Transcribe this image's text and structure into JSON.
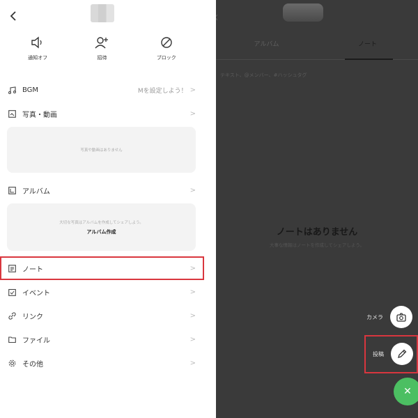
{
  "left": {
    "back_icon": "chevron-left-icon",
    "actions": [
      {
        "label": "通知オフ",
        "icon": "speaker-icon"
      },
      {
        "label": "招待",
        "icon": "add-user-icon"
      },
      {
        "label": "ブロック",
        "icon": "block-icon"
      }
    ],
    "bgm": {
      "label": "BGM",
      "extra": "Mを設定しよう！",
      "icon": "music-note-icon"
    },
    "photos": {
      "label": "写真・動画",
      "icon": "photo-icon",
      "empty_text": "写真や動画はありません"
    },
    "album": {
      "label": "アルバム",
      "icon": "album-icon",
      "empty_text": "大切な写真はアルバムを作成してシェアしよう。",
      "create_label": "アルバム作成"
    },
    "rows": [
      {
        "key": "note",
        "label": "ノート",
        "icon": "note-icon"
      },
      {
        "key": "event",
        "label": "イベント",
        "icon": "calendar-icon"
      },
      {
        "key": "link",
        "label": "リンク",
        "icon": "link-icon"
      },
      {
        "key": "file",
        "label": "ファイル",
        "icon": "folder-icon"
      },
      {
        "key": "other",
        "label": "その他",
        "icon": "gear-icon"
      }
    ],
    "chevron": ">",
    "highlight_color": "#d9363e"
  },
  "right": {
    "tabs": [
      {
        "label": "アルバム",
        "active": false
      },
      {
        "label": "ノート",
        "active": true
      }
    ],
    "search_placeholder": "テキスト、@メンバー、#ハッシュタグ",
    "empty_title": "ノートはありません",
    "empty_subtitle": "大事な情報はノートを作成してシェアしよう。",
    "fab_items": [
      {
        "label": "カメラ",
        "icon": "camera-icon"
      },
      {
        "label": "投稿",
        "icon": "pencil-icon"
      }
    ],
    "close_icon": "close-icon",
    "fab_color": "#4cbf62"
  }
}
